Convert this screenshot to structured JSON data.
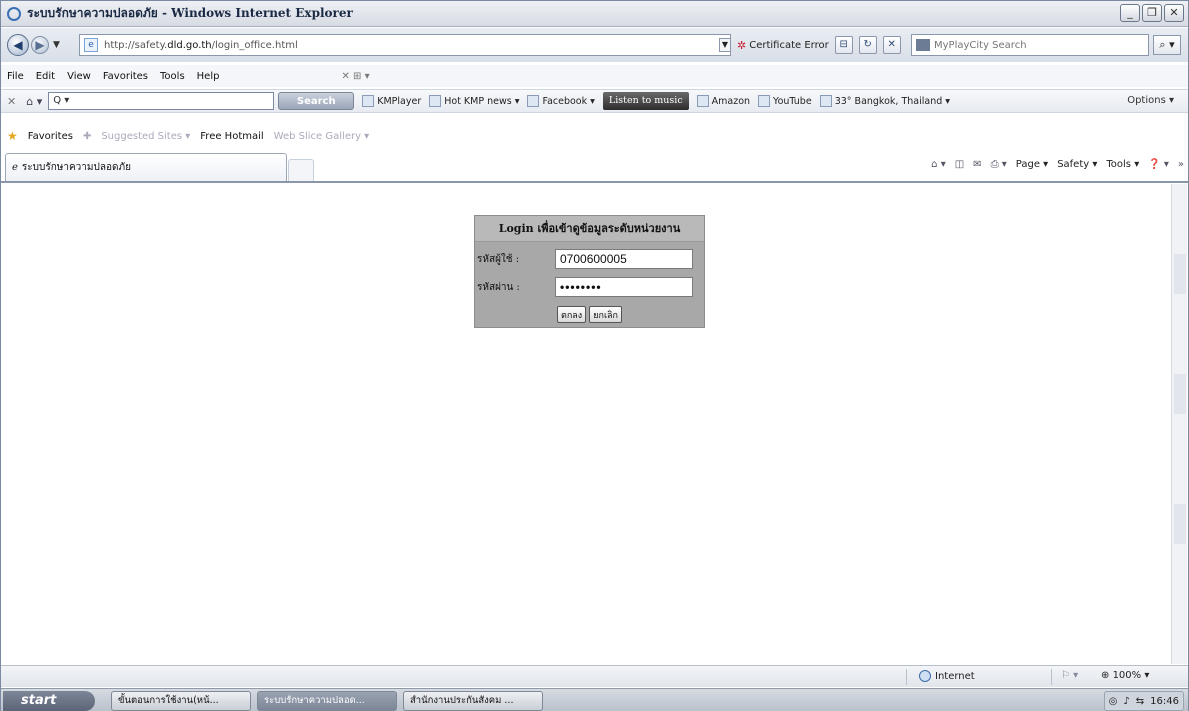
{
  "window": {
    "title": "ระบบรักษาความปลอดภัย - Windows Internet Explorer",
    "buttons": [
      "_",
      "❐",
      "✕"
    ]
  },
  "address": {
    "url_prefix": "http://safety.",
    "url_domain": "dld.go.th",
    "url_suffix": "/login_office.html",
    "cert_error": "Certificate Error",
    "search_placeholder": "MyPlayCity Search"
  },
  "menu": [
    "File",
    "Edit",
    "View",
    "Favorites",
    "Tools",
    "Help"
  ],
  "ask_toolbar": {
    "search_value": "Q ▾",
    "search_button": "Search",
    "links": [
      "KMPlayer",
      "Hot KMP news ▾",
      "Facebook ▾",
      "Amazon",
      "YouTube",
      "33° Bangkok, Thailand ▾"
    ],
    "listen_label": "Listen to music",
    "options_label": "Options ▾"
  },
  "favorites": {
    "label": "Favorites",
    "items": [
      "Suggested Sites ▾",
      "Free Hotmail",
      "Web Slice Gallery ▾"
    ]
  },
  "tab": {
    "title": "ระบบรักษาความปลอดภัย"
  },
  "commandbar": [
    "Page ▾",
    "Safety ▾",
    "Tools ▾"
  ],
  "login": {
    "heading": "Login เพื่อเข้าดูข้อมูลระดับหน่วยงาน",
    "user_label": "รหัสผู้ใช้ :",
    "user_value": "0700600005",
    "pass_label": "รหัสผ่าน :",
    "pass_value": "••••••••",
    "ok_button": "ตกลง",
    "cancel_button": "ยกเลิก"
  },
  "status": {
    "zone": "Internet",
    "zoom": "100%"
  },
  "taskbar": {
    "start": "start",
    "items": [
      "ขั้นตอนการใช้งาน(หน้...",
      "ระบบรักษาความปลอด...",
      "สำนักงานประกันสังคม ..."
    ],
    "clock": "16:46"
  }
}
